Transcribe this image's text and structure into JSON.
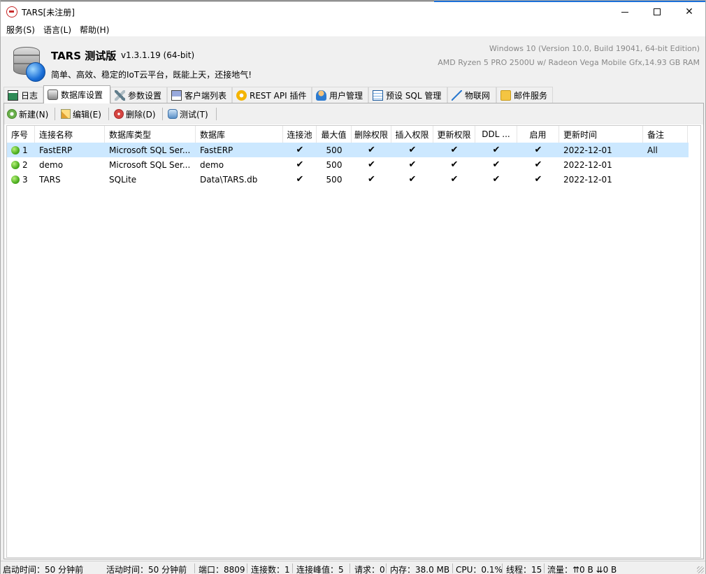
{
  "window": {
    "title": "TARS[未注册]"
  },
  "menu": [
    "服务(S)",
    "语言(L)",
    "帮助(H)"
  ],
  "header": {
    "app_name": "TARS 测试版",
    "version": "v1.3.1.19 (64-bit)",
    "slogan": "简单、高效、稳定的IoT云平台，既能上天，还接地气!",
    "os_info": "Windows 10 (Version 10.0, Build 19041, 64-bit Edition)",
    "hw_info": "AMD Ryzen 5 PRO 2500U w/ Radeon Vega Mobile Gfx,14.93 GB RAM"
  },
  "tabs": [
    {
      "label": "日志",
      "icon": "log-icon"
    },
    {
      "label": "数据库设置",
      "icon": "database-icon",
      "active": true
    },
    {
      "label": "参数设置",
      "icon": "wrench-icon"
    },
    {
      "label": "客户端列表",
      "icon": "client-icon"
    },
    {
      "label": "REST API 插件",
      "icon": "api-plugin-icon"
    },
    {
      "label": "用户管理",
      "icon": "user-icon"
    },
    {
      "label": "预设 SQL 管理",
      "icon": "sql-table-icon"
    },
    {
      "label": "物联网",
      "icon": "iot-icon"
    },
    {
      "label": "邮件服务",
      "icon": "mail-icon"
    }
  ],
  "toolbar": {
    "new_label": "新建(N)",
    "edit_label": "编辑(E)",
    "delete_label": "删除(D)",
    "test_label": "测试(T)"
  },
  "grid": {
    "columns": [
      "序号",
      "连接名称",
      "数据库类型",
      "数据库",
      "连接池",
      "最大值",
      "删除权限",
      "插入权限",
      "更新权限",
      "DDL ...",
      "启用",
      "更新时间",
      "备注"
    ],
    "check_glyph": "✔",
    "rows": [
      {
        "id": "1",
        "name": "FastERP",
        "type": "Microsoft SQL Ser...",
        "database": "FastERP",
        "max": "500",
        "updated": "2022-12-01",
        "note": "All",
        "selected": true
      },
      {
        "id": "2",
        "name": "demo",
        "type": "Microsoft SQL Ser...",
        "database": "demo",
        "max": "500",
        "updated": "2022-12-01",
        "note": ""
      },
      {
        "id": "3",
        "name": "TARS",
        "type": "SQLite",
        "database": "Data\\TARS.db",
        "max": "500",
        "updated": "2022-12-01",
        "note": ""
      }
    ]
  },
  "statusbar": {
    "start_time": "启动时间：50 分钟前",
    "active_time": "活动时间：50 分钟前",
    "port": "端口：8809",
    "connections": "连接数：1",
    "peak": "连接峰值：5",
    "requests": "请求：0",
    "memory": "内存：38.0 MB",
    "cpu": "CPU：0.1%",
    "threads": "线程：15",
    "traffic": "流量：⇈0 B ⇊0 B"
  }
}
